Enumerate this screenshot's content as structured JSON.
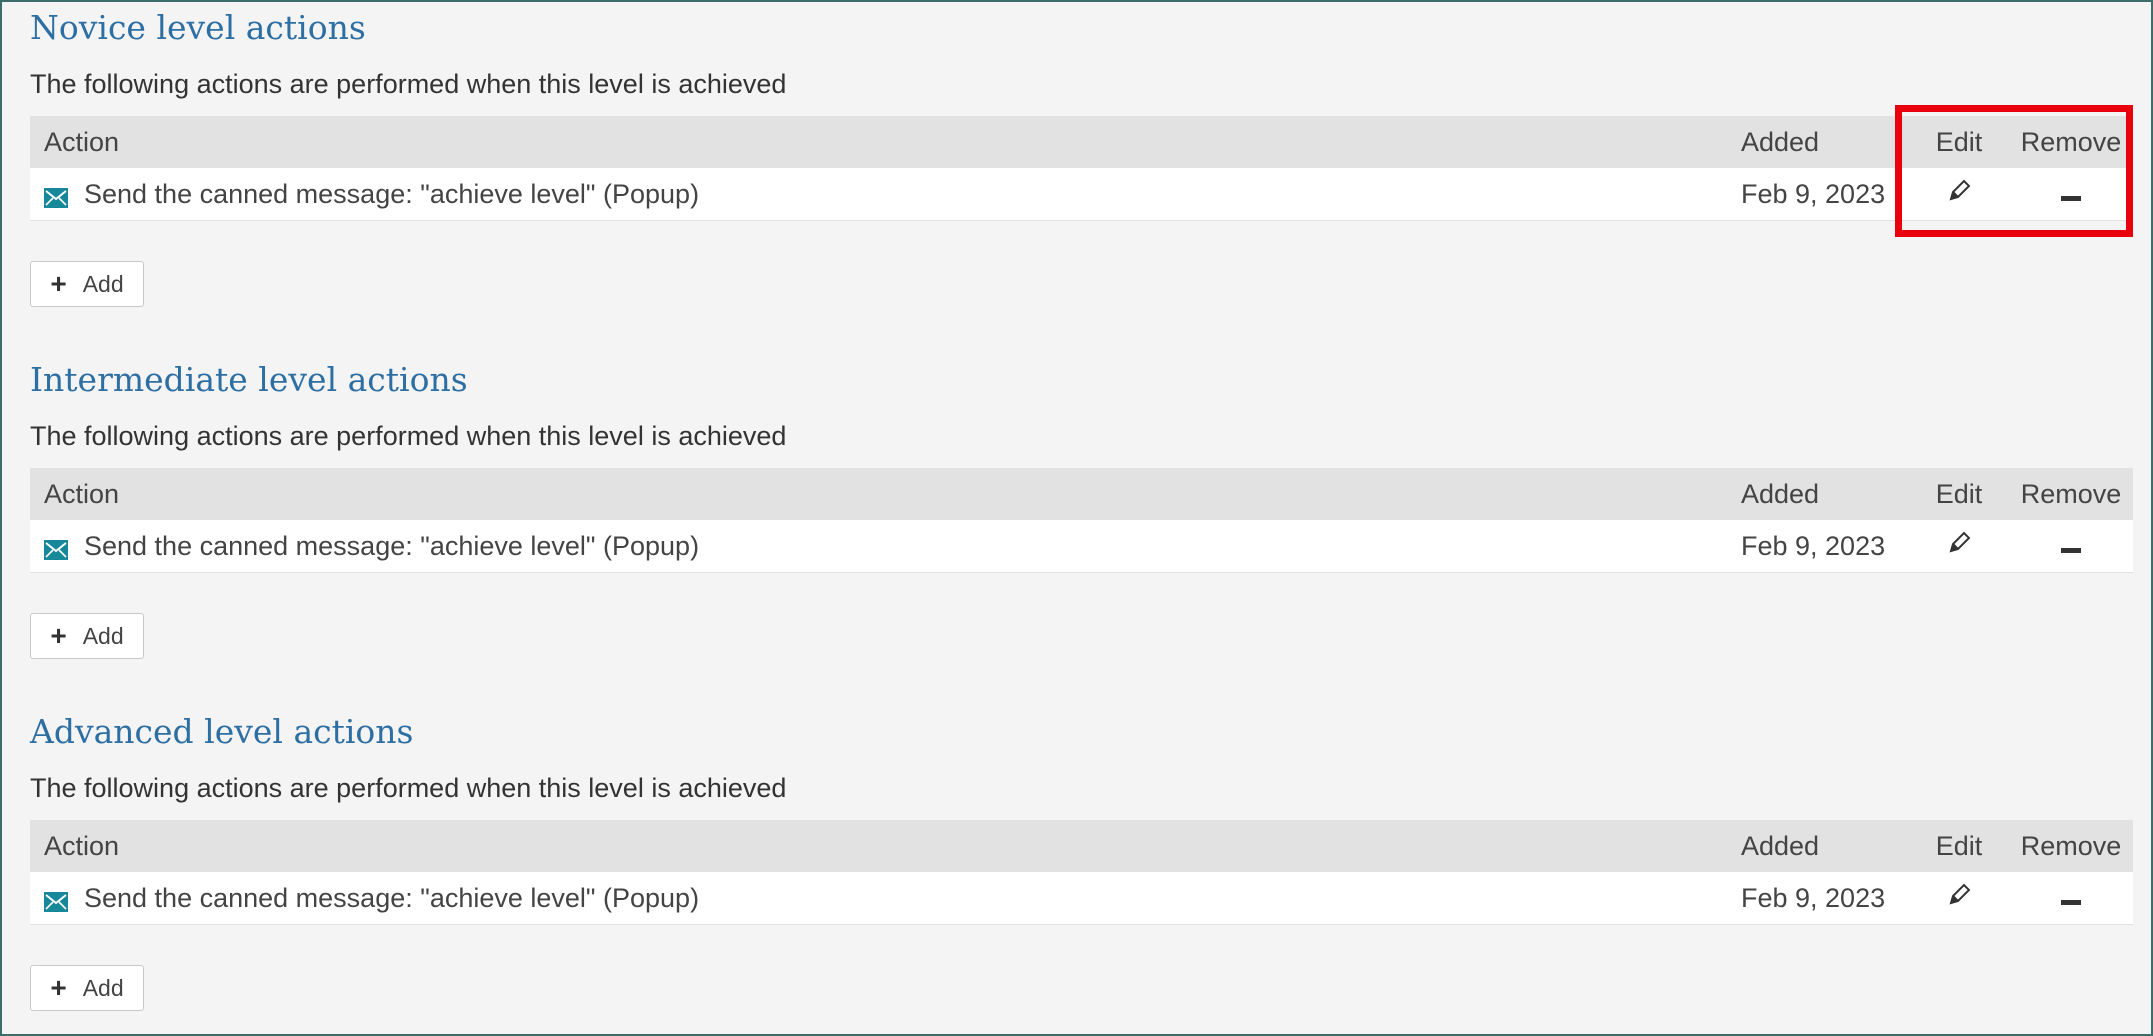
{
  "columns": {
    "action": "Action",
    "added": "Added",
    "edit": "Edit",
    "remove": "Remove"
  },
  "description": "The following actions are performed when this level is achieved",
  "add_label": "Add",
  "sections": [
    {
      "title": "Novice level actions",
      "rows": [
        {
          "action": "Send the canned message: \"achieve level\" (Popup)",
          "added": "Feb 9, 2023"
        }
      ]
    },
    {
      "title": "Intermediate level actions",
      "rows": [
        {
          "action": "Send the canned message: \"achieve level\" (Popup)",
          "added": "Feb 9, 2023"
        }
      ]
    },
    {
      "title": "Advanced level actions",
      "rows": [
        {
          "action": "Send the canned message: \"achieve level\" (Popup)",
          "added": "Feb 9, 2023"
        }
      ]
    }
  ],
  "icons": {
    "row_type": "envelope-icon",
    "edit": "pencil-icon",
    "remove": "minus-icon",
    "add": "plus-icon"
  },
  "colors": {
    "title": "#2e6fa3",
    "envelope": "#17879a",
    "highlight": "#e8000d",
    "frame": "#3b6e6a"
  }
}
